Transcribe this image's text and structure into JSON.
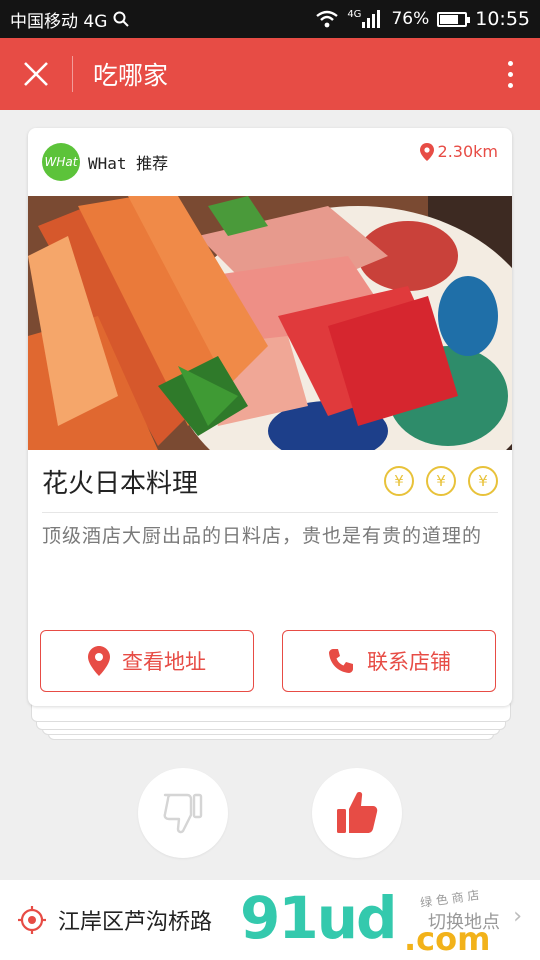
{
  "status_bar": {
    "carrier": "中国移动 4G",
    "network": "4G",
    "battery": "76%",
    "battery_level": 0.76,
    "time": "10:55"
  },
  "header": {
    "title": "吃哪家"
  },
  "card": {
    "source_logo": "WHat",
    "source_label": "WHat 推荐",
    "distance": "2.30km",
    "restaurant_name": "花火日本料理",
    "price_symbols": [
      "¥",
      "¥",
      "¥"
    ],
    "description": "顶级酒店大厨出品的日料店，贵也是有贵的道理的",
    "view_address_label": "查看地址",
    "contact_store_label": "联系店铺"
  },
  "location": {
    "address": "江岸区芦沟桥路",
    "switch_label": "切换地点"
  },
  "watermark": {
    "main": "91ud",
    "suffix": ".com",
    "small": "绿 色 商 店"
  },
  "colors": {
    "accent": "#e74c45",
    "price": "#e8c23a",
    "logo": "#5cc33a"
  }
}
